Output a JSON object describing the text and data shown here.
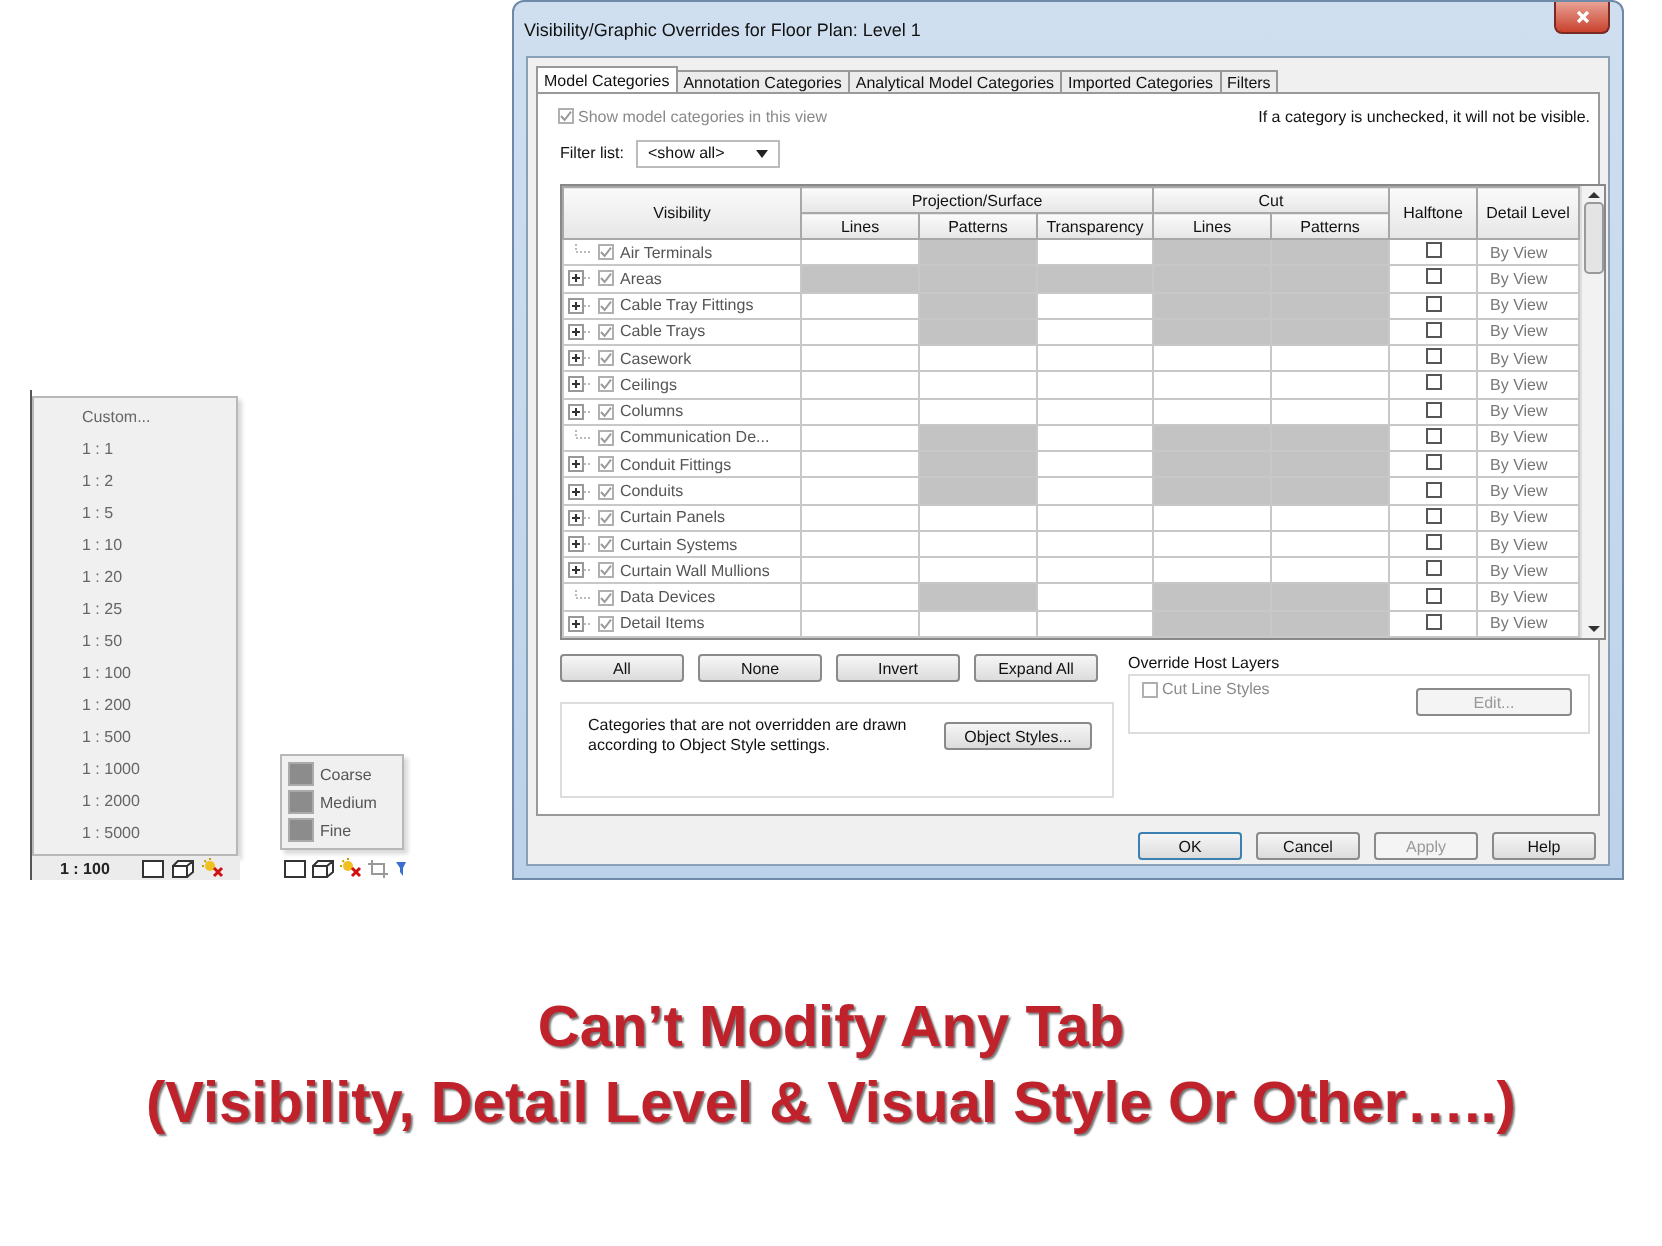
{
  "scale_menu": {
    "items": [
      "Custom...",
      "1 : 1",
      "1 : 2",
      "1 : 5",
      "1 : 10",
      "1 : 20",
      "1 : 25",
      "1 : 50",
      "1 : 100",
      "1 : 200",
      "1 : 500",
      "1 : 1000",
      "1 : 2000",
      "1 : 5000"
    ]
  },
  "scale_status": {
    "scale": "1 : 100"
  },
  "detail_menu": {
    "items": [
      "Coarse",
      "Medium",
      "Fine"
    ]
  },
  "dialog": {
    "title": "Visibility/Graphic Overrides for Floor Plan: Level 1",
    "tabs": [
      {
        "label": "Model Categories",
        "selected": true
      },
      {
        "label": "Annotation Categories",
        "selected": false
      },
      {
        "label": "Analytical Model Categories",
        "selected": false
      },
      {
        "label": "Imported Categories",
        "selected": false
      },
      {
        "label": "Filters",
        "selected": false
      }
    ],
    "show_categories": {
      "label": "Show model categories in this view",
      "checked": true,
      "disabled": true
    },
    "hint": "If a category is unchecked, it will not be visible.",
    "filter": {
      "label": "Filter list:",
      "value": "<show all>"
    },
    "table": {
      "columns": {
        "visibility": "Visibility",
        "projection": "Projection/Surface",
        "projection_columns": [
          "Lines",
          "Patterns",
          "Transparency"
        ],
        "cut": "Cut",
        "cut_columns": [
          "Lines",
          "Patterns"
        ],
        "halftone": "Halftone",
        "detail_level": "Detail Level"
      },
      "rows": [
        {
          "name": "Air Terminals",
          "expandable": false,
          "visible": true,
          "greyed": [
            false,
            true,
            false,
            true,
            true
          ],
          "halftone": false,
          "detail": "By View"
        },
        {
          "name": "Areas",
          "expandable": true,
          "visible": true,
          "greyed": [
            true,
            true,
            true,
            true,
            true
          ],
          "halftone": false,
          "detail": "By View"
        },
        {
          "name": "Cable Tray Fittings",
          "expandable": true,
          "visible": true,
          "greyed": [
            false,
            true,
            false,
            true,
            true
          ],
          "halftone": false,
          "detail": "By View"
        },
        {
          "name": "Cable Trays",
          "expandable": true,
          "visible": true,
          "greyed": [
            false,
            true,
            false,
            true,
            true
          ],
          "halftone": false,
          "detail": "By View"
        },
        {
          "name": "Casework",
          "expandable": true,
          "visible": true,
          "greyed": [
            false,
            false,
            false,
            false,
            false
          ],
          "halftone": false,
          "detail": "By View"
        },
        {
          "name": "Ceilings",
          "expandable": true,
          "visible": true,
          "greyed": [
            false,
            false,
            false,
            false,
            false
          ],
          "halftone": false,
          "detail": "By View"
        },
        {
          "name": "Columns",
          "expandable": true,
          "visible": true,
          "greyed": [
            false,
            false,
            false,
            false,
            false
          ],
          "halftone": false,
          "detail": "By View"
        },
        {
          "name": "Communication De...",
          "expandable": false,
          "visible": true,
          "greyed": [
            false,
            true,
            false,
            true,
            true
          ],
          "halftone": false,
          "detail": "By View"
        },
        {
          "name": "Conduit Fittings",
          "expandable": true,
          "visible": true,
          "greyed": [
            false,
            true,
            false,
            true,
            true
          ],
          "halftone": false,
          "detail": "By View"
        },
        {
          "name": "Conduits",
          "expandable": true,
          "visible": true,
          "greyed": [
            false,
            true,
            false,
            true,
            true
          ],
          "halftone": false,
          "detail": "By View"
        },
        {
          "name": "Curtain Panels",
          "expandable": true,
          "visible": true,
          "greyed": [
            false,
            false,
            false,
            false,
            false
          ],
          "halftone": false,
          "detail": "By View"
        },
        {
          "name": "Curtain Systems",
          "expandable": true,
          "visible": true,
          "greyed": [
            false,
            false,
            false,
            false,
            false
          ],
          "halftone": false,
          "detail": "By View"
        },
        {
          "name": "Curtain Wall Mullions",
          "expandable": true,
          "visible": true,
          "greyed": [
            false,
            false,
            false,
            false,
            false
          ],
          "halftone": false,
          "detail": "By View"
        },
        {
          "name": "Data Devices",
          "expandable": false,
          "visible": true,
          "greyed": [
            false,
            true,
            false,
            true,
            true
          ],
          "halftone": false,
          "detail": "By View"
        },
        {
          "name": "Detail Items",
          "expandable": true,
          "visible": true,
          "greyed": [
            false,
            false,
            false,
            true,
            true
          ],
          "halftone": false,
          "detail": "By View"
        }
      ]
    },
    "table_buttons": [
      "All",
      "None",
      "Invert",
      "Expand All"
    ],
    "note": {
      "text": "Categories that are not overridden are drawn according to Object Style settings.",
      "button": "Object Styles..."
    },
    "host_layers": {
      "title": "Override Host Layers",
      "checkbox": {
        "label": "Cut Line Styles",
        "checked": false,
        "disabled": true
      },
      "button": {
        "label": "Edit...",
        "disabled": true
      }
    },
    "buttons": [
      {
        "label": "OK",
        "default": true,
        "disabled": false
      },
      {
        "label": "Cancel",
        "default": false,
        "disabled": false
      },
      {
        "label": "Apply",
        "default": false,
        "disabled": true
      },
      {
        "label": "Help",
        "default": false,
        "disabled": false
      }
    ]
  },
  "caption": [
    "Can’t Modify Any Tab",
    "(Visibility, Detail Level & Visual Style Or Other…..)"
  ]
}
